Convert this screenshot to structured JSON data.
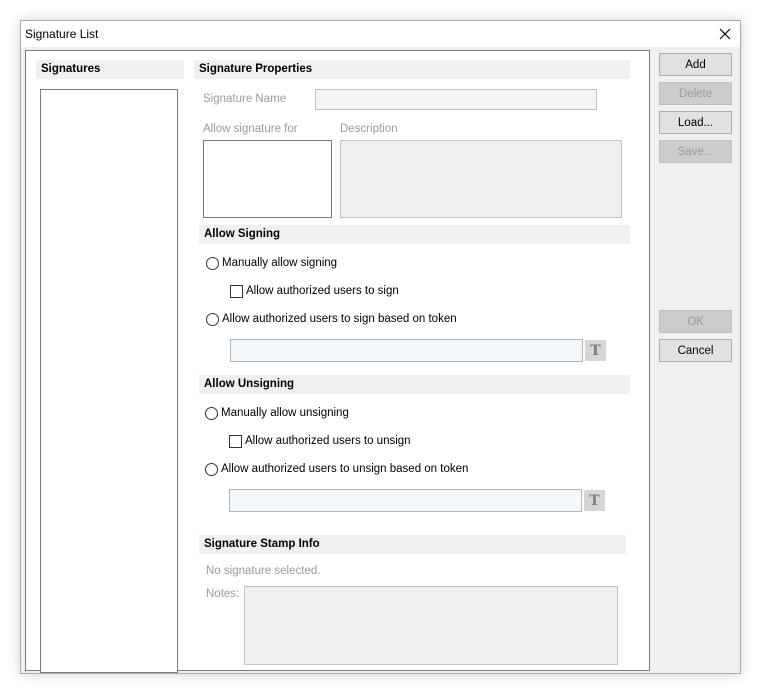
{
  "window": {
    "title": "Signature List"
  },
  "signatures_panel": {
    "header": "Signatures"
  },
  "properties": {
    "header": "Signature Properties",
    "name_label": "Signature Name",
    "allow_for_label": "Allow signature for",
    "description_label": "Description"
  },
  "allow_signing": {
    "header": "Allow Signing",
    "manual_label": "Manually allow signing",
    "authorized_label": "Allow authorized users to sign",
    "token_label": "Allow authorized users to sign based on token",
    "token_value": ""
  },
  "allow_unsigning": {
    "header": "Allow Unsigning",
    "manual_label": "Manually allow unsigning",
    "authorized_label": "Allow authorized users to unsign",
    "token_label": "Allow authorized users to unsign based on token",
    "token_value": ""
  },
  "stamp": {
    "header": "Signature Stamp Info",
    "status": "No signature selected.",
    "notes_label": "Notes:"
  },
  "token_button_glyph": "T",
  "buttons": {
    "add": "Add",
    "delete": "Delete",
    "load": "Load...",
    "save": "Save...",
    "ok": "OK",
    "cancel": "Cancel"
  },
  "icons": {
    "close": "close-icon",
    "token": "token-icon"
  }
}
